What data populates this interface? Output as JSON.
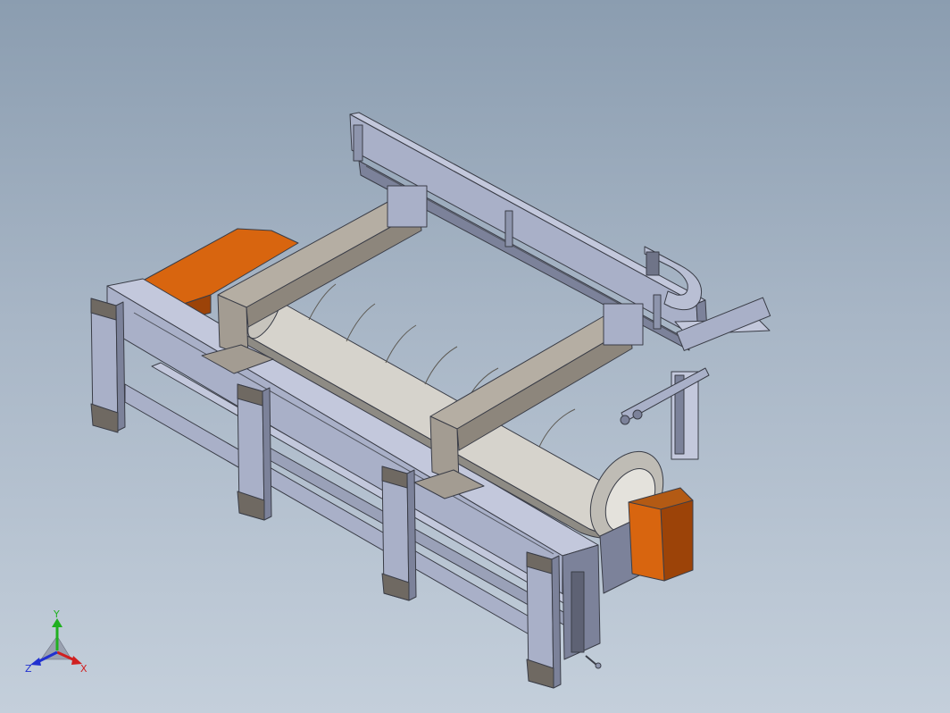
{
  "viewport": {
    "model_name": "",
    "colors": {
      "background_top": "#8b9db0",
      "background_bottom": "#c4cfdb",
      "frame": "#a9b0c8",
      "frame_dark": "#7c829a",
      "beam": "#a39c92",
      "beam_dark": "#7f786f",
      "drum": "#d6d3cc",
      "drum_dark": "#8e8b84",
      "orange": "#d8650f",
      "orange_dark": "#9c4308",
      "edge": "#3a3d47"
    }
  },
  "triad": {
    "x_label": "X",
    "y_label": "Y",
    "z_label": "Z",
    "x_color": "#d02020",
    "y_color": "#20b020",
    "z_color": "#2030d0"
  }
}
